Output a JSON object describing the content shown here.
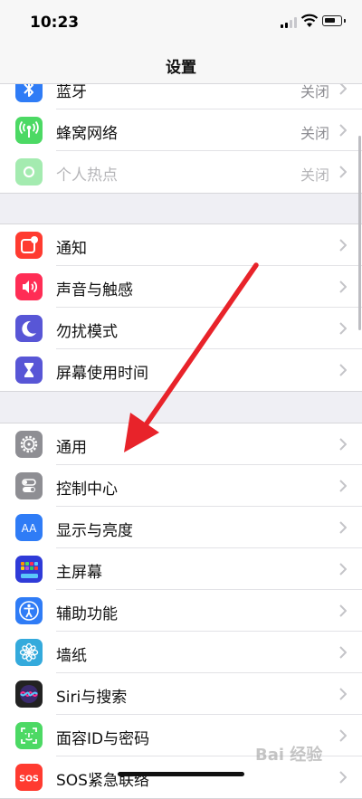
{
  "status_bar": {
    "time": "10:23"
  },
  "nav": {
    "title": "设置"
  },
  "groups": [
    {
      "rows": [
        {
          "label": "蓝牙",
          "value": "关闭",
          "icon": "bluetooth-icon",
          "color": "#2f7cf6"
        },
        {
          "label": "蜂窝网络",
          "value": "关闭",
          "icon": "cellular-icon",
          "color": "#4cd964"
        },
        {
          "label": "个人热点",
          "value": "关闭",
          "icon": "hotspot-icon",
          "color": "#4cd964"
        }
      ]
    },
    {
      "rows": [
        {
          "label": "通知",
          "icon": "notifications-icon",
          "color": "#ff3b30"
        },
        {
          "label": "声音与触感",
          "icon": "sound-icon",
          "color": "#ff2d55"
        },
        {
          "label": "勿扰模式",
          "icon": "moon-icon",
          "color": "#5856d6"
        },
        {
          "label": "屏幕使用时间",
          "icon": "hourglass-icon",
          "color": "#5856d6"
        }
      ]
    },
    {
      "rows": [
        {
          "label": "通用",
          "icon": "gear-icon",
          "color": "#8e8e93"
        },
        {
          "label": "控制中心",
          "icon": "control-center-icon",
          "color": "#8e8e93"
        },
        {
          "label": "显示与亮度",
          "icon": "display-brightness-icon",
          "color": "#2f7cf6"
        },
        {
          "label": "主屏幕",
          "icon": "home-screen-icon",
          "color": "#2f3bd8"
        },
        {
          "label": "辅助功能",
          "icon": "accessibility-icon",
          "color": "#2f7cf6"
        },
        {
          "label": "墙纸",
          "icon": "wallpaper-icon",
          "color": "#34aadc"
        },
        {
          "label": "Siri与搜索",
          "icon": "siri-icon",
          "color": "#222222"
        },
        {
          "label": "面容ID与密码",
          "icon": "face-id-icon",
          "color": "#4cd964"
        },
        {
          "label": "SOS紧急联络",
          "icon": "sos-icon",
          "color": "#ff3b30"
        }
      ]
    }
  ],
  "watermark": {
    "text": "Bai 经验"
  }
}
